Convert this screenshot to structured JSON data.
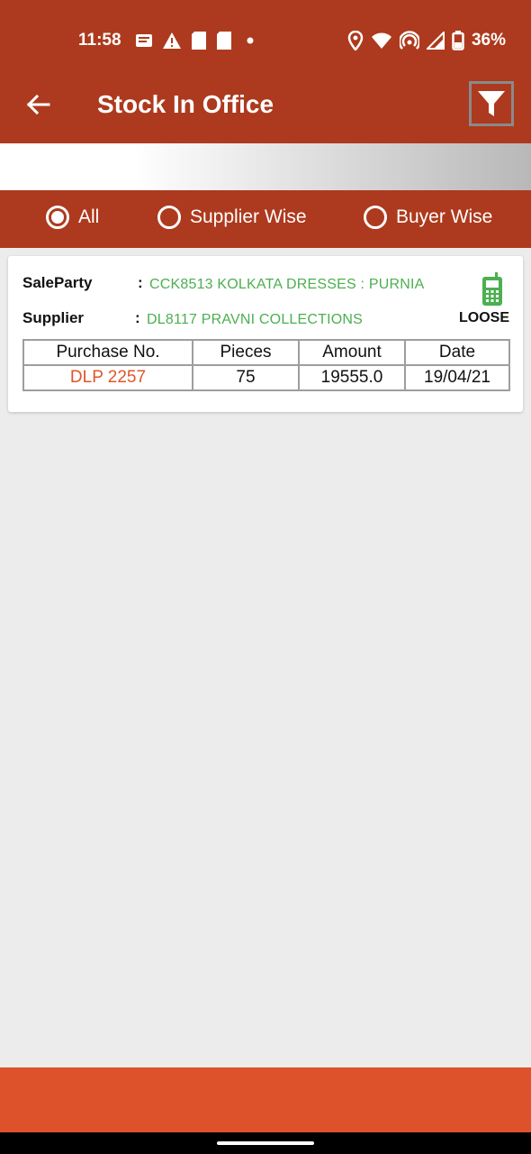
{
  "status_bar": {
    "time": "11:58",
    "battery": "36%",
    "icons_left": [
      "message-icon",
      "alert-icon",
      "sim-card-icon",
      "sim-card-icon",
      "dot-icon"
    ],
    "icons_right": [
      "location-icon",
      "wifi-icon",
      "hotspot-icon",
      "signal-icon",
      "battery-icon"
    ]
  },
  "app_bar": {
    "title": "Stock In Office",
    "back_icon": "arrow-left-icon",
    "filter_icon": "funnel-icon"
  },
  "filter_options": {
    "selected": "All",
    "options": [
      "All",
      "Supplier Wise",
      "Buyer Wise"
    ]
  },
  "card": {
    "sale_party_label": "SaleParty",
    "sale_party_value": "CCK8513 KOLKATA DRESSES : PURNIA",
    "supplier_label": "Supplier",
    "supplier_value": "DL8117 PRAVNI  COLLECTIONS",
    "colon": ":",
    "type_label": "LOOSE",
    "type_icon": "mobile-phone-icon",
    "table": {
      "headers": [
        "Purchase No.",
        "Pieces",
        "Amount",
        "Date"
      ],
      "rows": [
        [
          "DLP 2257",
          "75",
          "19555.0",
          "19/04/21"
        ]
      ]
    }
  },
  "colors": {
    "primary": "#ad3a1e",
    "bottom_bar": "#de522b",
    "value_green": "#4caf50",
    "purchase_link": "#e0552a",
    "background": "#ececec"
  }
}
